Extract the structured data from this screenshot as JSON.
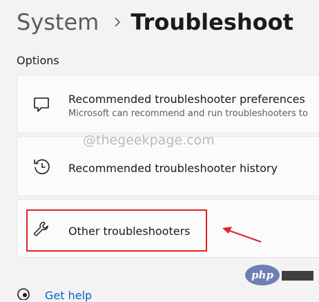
{
  "breadcrumb": {
    "parent": "System",
    "current": "Troubleshoot"
  },
  "section_label": "Options",
  "options": [
    {
      "title": "Recommended troubleshooter preferences",
      "subtitle": "Microsoft can recommend and run troubleshooters to",
      "icon": "message-icon"
    },
    {
      "title": "Recommended troubleshooter history",
      "icon": "history-icon"
    },
    {
      "title": "Other troubleshooters",
      "icon": "wrench-icon"
    }
  ],
  "watermark": "@thegeekpage.com",
  "php_badge": "php",
  "get_help": {
    "label": "Get help",
    "icon": "help-icon"
  },
  "colors": {
    "highlight": "#e32324",
    "link": "#0067c0",
    "php": "#6e7fb4"
  }
}
